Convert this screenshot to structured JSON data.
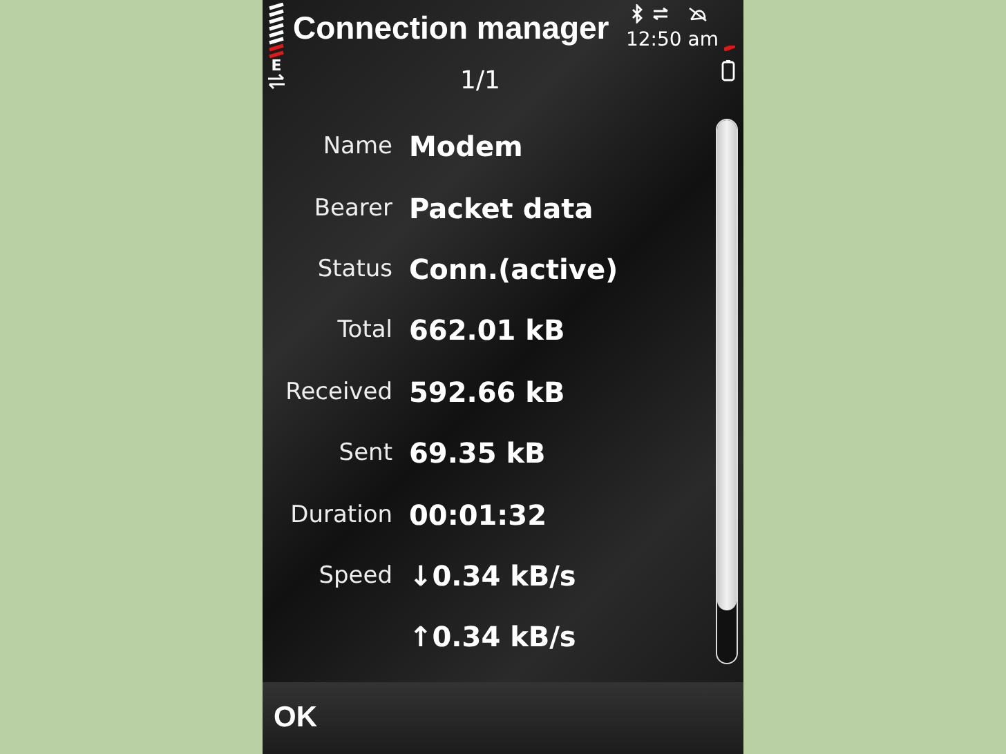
{
  "window": {
    "title": "Connection manager"
  },
  "status": {
    "time": "12:50 am",
    "network_type": "E"
  },
  "pager": "1/1",
  "details": [
    {
      "label": "Name",
      "value": "Modem"
    },
    {
      "label": "Bearer",
      "value": "Packet data"
    },
    {
      "label": "Status",
      "value": "Conn.(active)"
    },
    {
      "label": "Total",
      "value": "662.01 kB"
    },
    {
      "label": "Received",
      "value": "592.66 kB"
    },
    {
      "label": "Sent",
      "value": "69.35 kB"
    },
    {
      "label": "Duration",
      "value": "00:01:32"
    },
    {
      "label": "Speed",
      "value": "↓0.34 kB/s"
    },
    {
      "value": "↑0.34 kB/s"
    }
  ],
  "softkeys": [
    "OK"
  ]
}
